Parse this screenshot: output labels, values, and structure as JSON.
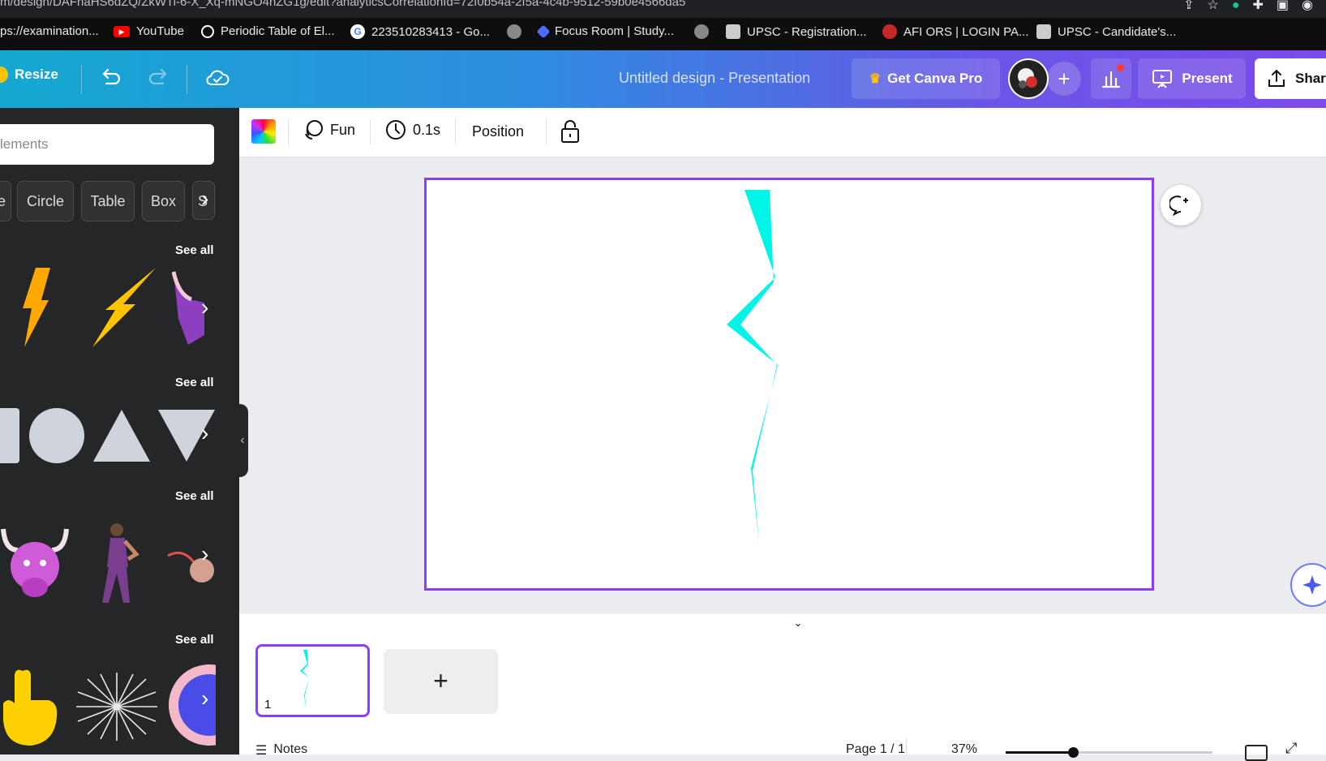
{
  "browser": {
    "url": "m/design/DAFhaHS6dZQ/ZkWTi-6-X_Xq-mNGO4nZG1g/edit?analyticsCorrelationId=72f0b54a-2f5a-4c4b-9512-59b0e4566da5",
    "bookmarks": [
      {
        "label": "ps://examination...",
        "icon": "page-icon"
      },
      {
        "label": "YouTube",
        "icon": "youtube-icon"
      },
      {
        "label": "Periodic Table of El...",
        "icon": "site-icon"
      },
      {
        "label": "223510283413 - Go...",
        "icon": "google-icon"
      },
      {
        "label": "",
        "icon": "globe-icon"
      },
      {
        "label": "Focus Room | Study...",
        "icon": "focus-icon"
      },
      {
        "label": "",
        "icon": "globe-icon"
      },
      {
        "label": "UPSC - Registration...",
        "icon": "upsc-icon"
      },
      {
        "label": "AFI ORS | LOGIN PA...",
        "icon": "afi-icon"
      },
      {
        "label": "UPSC - Candidate's...",
        "icon": "upsc-icon"
      }
    ]
  },
  "topbar": {
    "resize_label": "Resize",
    "design_title": "Untitled design - Presentation",
    "get_pro_label": "Get Canva Pro",
    "present_label": "Present",
    "share_label": "Shar"
  },
  "sidepanel": {
    "search_placeholder": "lements",
    "chips": [
      "e",
      "Circle",
      "Table",
      "Box",
      "S"
    ],
    "see_all_labels": [
      "See all",
      "See all",
      "See all",
      "See all"
    ]
  },
  "toolbar": {
    "animation_label": "Fun",
    "duration_label": "0.1s",
    "position_label": "Position"
  },
  "filmstrip": {
    "page_number": "1",
    "add_page_label": "+"
  },
  "footer": {
    "notes_label": "Notes",
    "page_indicator": "Page 1 / 1",
    "zoom_label": "37%"
  },
  "colors": {
    "accent": "#8b3dff",
    "lightning": "#00f5e6",
    "gradient_start": "#14a8d1",
    "gradient_end": "#7b4be8"
  }
}
